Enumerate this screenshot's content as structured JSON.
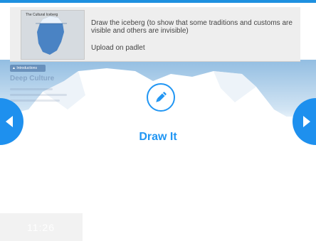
{
  "task": {
    "instruction": "Draw the iceberg (to show that some traditions and customs are visible and others are invisible)",
    "upload_line": "Upload on padlet",
    "thumbnail_title": "The Cultural Iceberg"
  },
  "background_hint": {
    "pill_label": "▲ Introductions",
    "heading": "Deep Culture"
  },
  "activity": {
    "label": "Draw It",
    "icon": "pencil-icon"
  },
  "navigation": {
    "prev_icon": "chevron-left-icon",
    "next_icon": "chevron-right-icon"
  },
  "timer": {
    "value": "11:26"
  },
  "colors": {
    "accent": "#2196f3",
    "nav": "#1e90ee",
    "top_bar": "#1e90e0"
  }
}
